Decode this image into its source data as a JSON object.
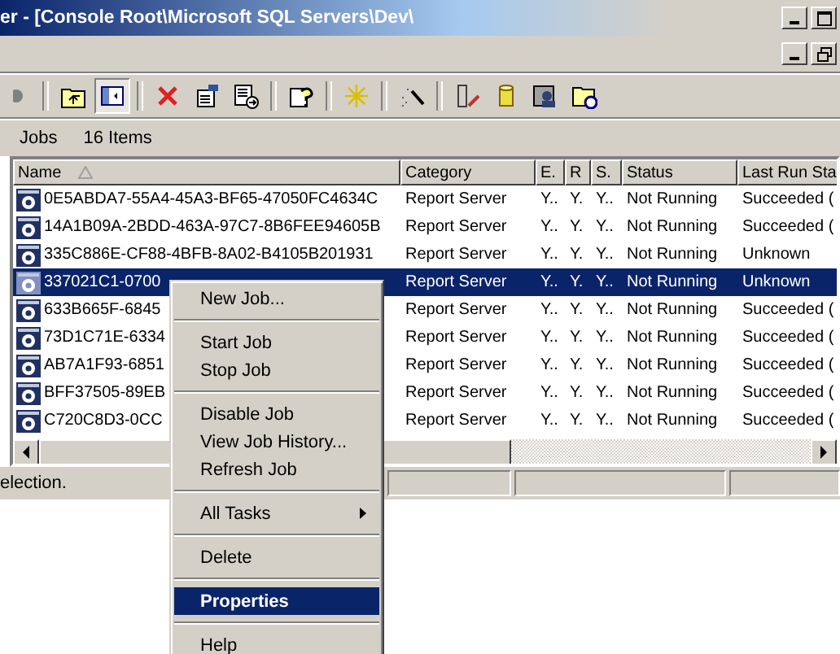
{
  "window": {
    "title": "er - [Console Root\\Microsoft SQL Servers\\Dev\\"
  },
  "toolbar": [
    {
      "kind": "back",
      "pressed": false
    },
    {
      "kind": "sep"
    },
    {
      "kind": "up",
      "pressed": false
    },
    {
      "kind": "tree",
      "pressed": true
    },
    {
      "kind": "sep"
    },
    {
      "kind": "delete",
      "pressed": false
    },
    {
      "kind": "properties",
      "pressed": false
    },
    {
      "kind": "export",
      "pressed": false
    },
    {
      "kind": "sep"
    },
    {
      "kind": "help",
      "pressed": false
    },
    {
      "kind": "sep"
    },
    {
      "kind": "new",
      "pressed": false
    },
    {
      "kind": "sep"
    },
    {
      "kind": "wizard",
      "pressed": false
    },
    {
      "kind": "sep"
    },
    {
      "kind": "edit",
      "pressed": false
    },
    {
      "kind": "database",
      "pressed": false
    },
    {
      "kind": "agent",
      "pressed": false
    },
    {
      "kind": "schedule",
      "pressed": false
    }
  ],
  "pane": {
    "title": "Jobs",
    "count": "16 Items"
  },
  "table": {
    "columns": [
      {
        "label": "Name",
        "sorted": true
      },
      {
        "label": "Category",
        "sorted": false
      },
      {
        "label": "E.",
        "sorted": false
      },
      {
        "label": "R",
        "sorted": false
      },
      {
        "label": "S.",
        "sorted": false
      },
      {
        "label": "Status",
        "sorted": false
      },
      {
        "label": "Last Run Sta",
        "sorted": false
      }
    ],
    "rows": [
      {
        "name": "0E5ABDA7-55A4-45A3-BF65-47050FC4634C",
        "category": "Report Server",
        "e": "Y..",
        "r": "Y.",
        "s": "Y..",
        "status": "Not Running",
        "last_run": "Succeeded (",
        "selected": false
      },
      {
        "name": "14A1B09A-2BDD-463A-97C7-8B6FEE94605B",
        "category": "Report Server",
        "e": "Y..",
        "r": "Y.",
        "s": "Y..",
        "status": "Not Running",
        "last_run": "Succeeded (",
        "selected": false
      },
      {
        "name": "335C886E-CF88-4BFB-8A02-B4105B201931",
        "category": "Report Server",
        "e": "Y..",
        "r": "Y.",
        "s": "Y..",
        "status": "Not Running",
        "last_run": "Unknown",
        "selected": false
      },
      {
        "name": "337021C1-0700",
        "category": "Report Server",
        "e": "Y..",
        "r": "Y.",
        "s": "Y..",
        "status": "Not Running",
        "last_run": "Unknown",
        "selected": true
      },
      {
        "name": "633B665F-6845",
        "category": "Report Server",
        "e": "Y..",
        "r": "Y.",
        "s": "Y..",
        "status": "Not Running",
        "last_run": "Succeeded (",
        "selected": false
      },
      {
        "name": "73D1C71E-6334",
        "category": "Report Server",
        "e": "Y..",
        "r": "Y.",
        "s": "Y..",
        "status": "Not Running",
        "last_run": "Succeeded (",
        "selected": false
      },
      {
        "name": "AB7A1F93-6851",
        "category": "Report Server",
        "e": "Y..",
        "r": "Y.",
        "s": "Y..",
        "status": "Not Running",
        "last_run": "Succeeded (",
        "selected": false
      },
      {
        "name": "BFF37505-89EB",
        "category": "Report Server",
        "e": "Y..",
        "r": "Y.",
        "s": "Y..",
        "status": "Not Running",
        "last_run": "Succeeded (",
        "selected": false
      },
      {
        "name": "C720C8D3-0CC",
        "category": "Report Server",
        "e": "Y..",
        "r": "Y.",
        "s": "Y..",
        "status": "Not Running",
        "last_run": "Succeeded (",
        "selected": false
      }
    ]
  },
  "status_bar": {
    "text": "election."
  },
  "context_menu": {
    "items": [
      {
        "kind": "item",
        "label": "New Job...",
        "selected": false
      },
      {
        "kind": "separator"
      },
      {
        "kind": "item",
        "label": "Start Job",
        "selected": false
      },
      {
        "kind": "item",
        "label": "Stop Job",
        "selected": false
      },
      {
        "kind": "separator"
      },
      {
        "kind": "item",
        "label": "Disable Job",
        "selected": false
      },
      {
        "kind": "item",
        "label": "View Job History...",
        "selected": false
      },
      {
        "kind": "item",
        "label": "Refresh Job",
        "selected": false
      },
      {
        "kind": "separator"
      },
      {
        "kind": "submenu",
        "label": "All Tasks",
        "selected": false
      },
      {
        "kind": "separator"
      },
      {
        "kind": "item",
        "label": "Delete",
        "selected": false
      },
      {
        "kind": "separator"
      },
      {
        "kind": "item",
        "label": "Properties",
        "selected": true
      },
      {
        "kind": "separator"
      },
      {
        "kind": "item",
        "label": "Help",
        "selected": false
      }
    ]
  }
}
